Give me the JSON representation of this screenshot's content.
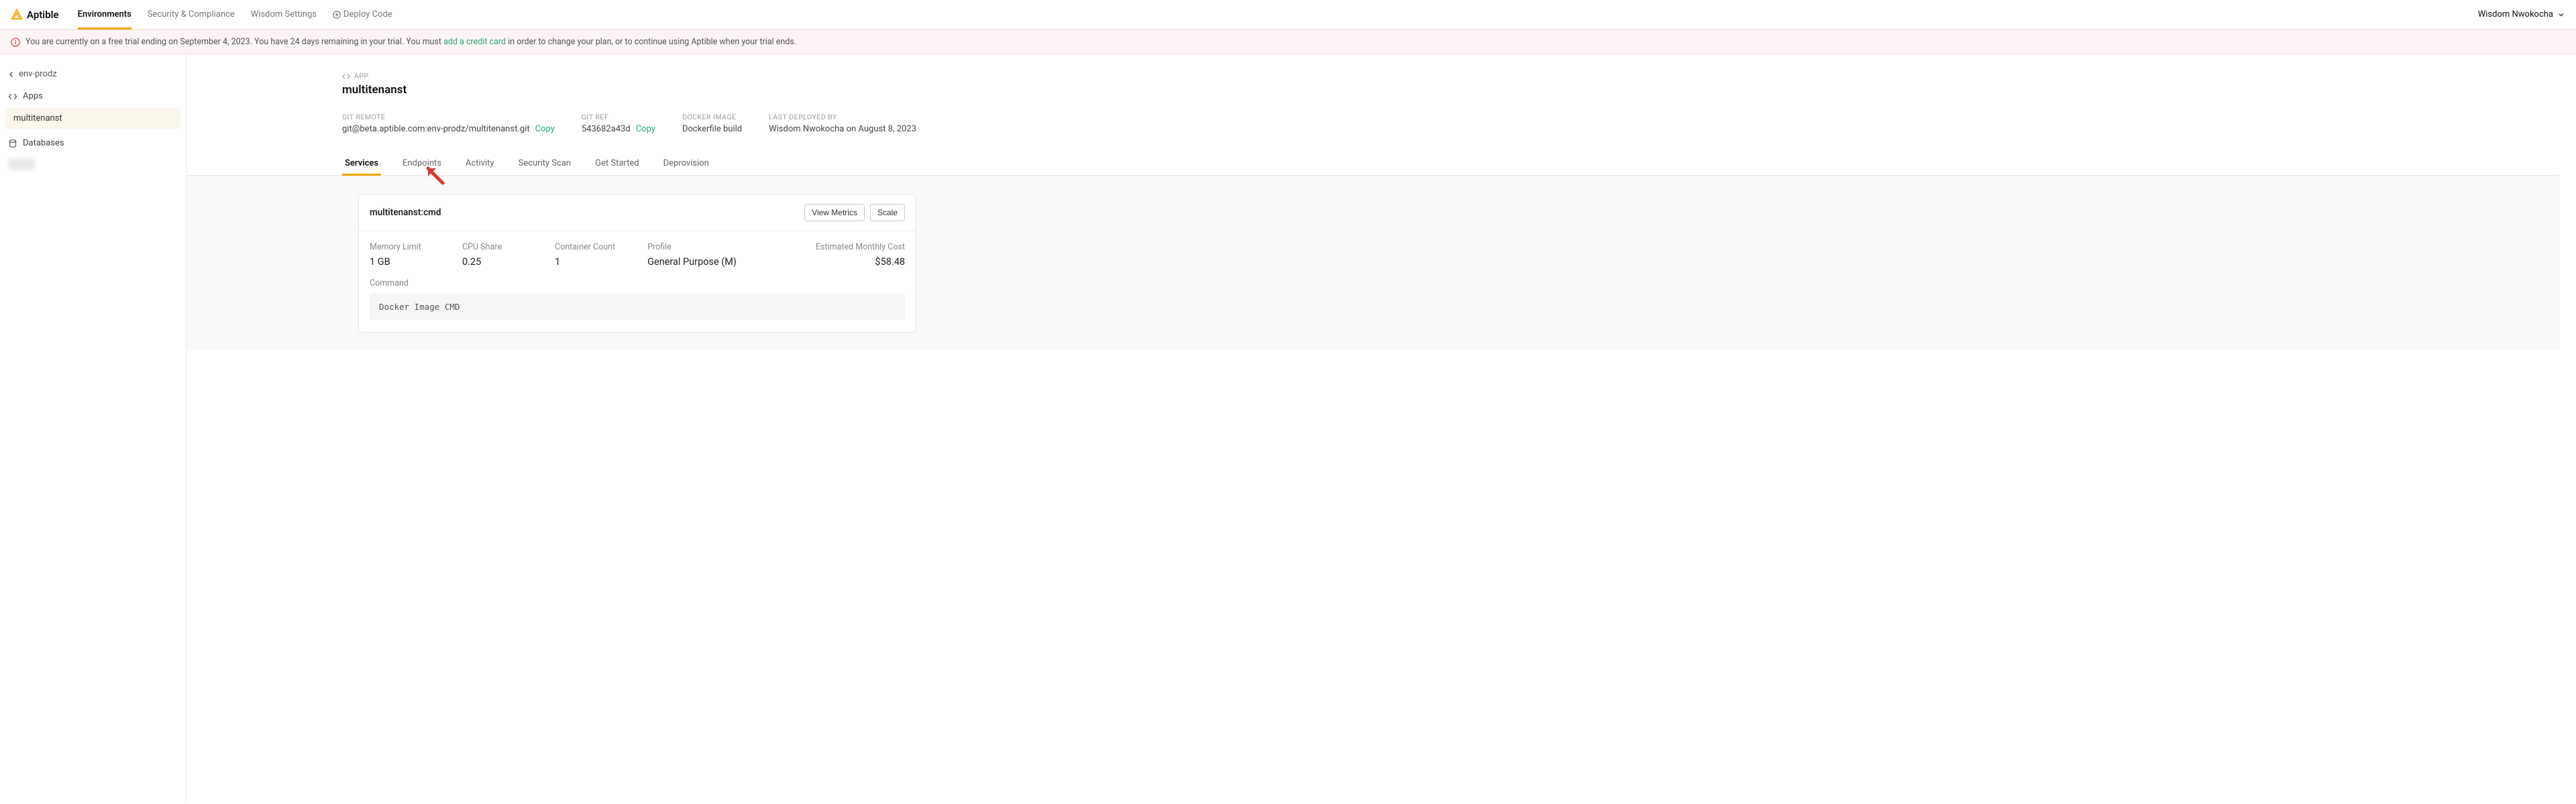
{
  "brand": {
    "name": "Aptible"
  },
  "topnav": {
    "items": [
      {
        "label": "Environments",
        "active": true
      },
      {
        "label": "Security & Compliance"
      },
      {
        "label": "Wisdom Settings"
      },
      {
        "label": "Deploy Code",
        "icon": "plus"
      }
    ],
    "user": "Wisdom Nwokocha"
  },
  "banner": {
    "text_before": "You are currently on a free trial ending on September 4, 2023. You have 24 days remaining in your trial. You must ",
    "link_text": "add a credit card",
    "text_after": " in order to change your plan, or to continue using Aptible when your trial ends."
  },
  "sidebar": {
    "back_label": "env-prodz",
    "sections": [
      {
        "icon": "code",
        "label": "Apps",
        "items": [
          {
            "label": "multitenanst",
            "active": true
          }
        ]
      },
      {
        "icon": "database",
        "label": "Databases",
        "items": []
      }
    ]
  },
  "header": {
    "crumb_label": "APP",
    "title": "multitenanst",
    "meta": {
      "git_remote": {
        "label": "GIT REMOTE",
        "value": "git@beta.aptible.com:env-prodz/multitenanst.git",
        "copy": "Copy"
      },
      "git_ref": {
        "label": "GIT REF",
        "value": "543682a43d",
        "copy": "Copy"
      },
      "docker_image": {
        "label": "DOCKER IMAGE",
        "value": "Dockerfile build"
      },
      "last_deployed": {
        "label": "LAST DEPLOYED BY",
        "value": "Wisdom Nwokocha on August 8, 2023"
      }
    }
  },
  "tabs": [
    {
      "label": "Services",
      "active": true
    },
    {
      "label": "Endpoints"
    },
    {
      "label": "Activity"
    },
    {
      "label": "Security Scan"
    },
    {
      "label": "Get Started"
    },
    {
      "label": "Deprovision"
    }
  ],
  "service_card": {
    "title": "multitenanst:cmd",
    "buttons": {
      "metrics": "View Metrics",
      "scale": "Scale"
    },
    "stats": {
      "memory_limit": {
        "label": "Memory Limit",
        "value": "1 GB"
      },
      "cpu_share": {
        "label": "CPU Share",
        "value": "0.25"
      },
      "container_count": {
        "label": "Container Count",
        "value": "1"
      },
      "profile": {
        "label": "Profile",
        "value": "General Purpose (M)"
      },
      "cost": {
        "label": "Estimated Monthly Cost",
        "value": "$58.48"
      }
    },
    "command": {
      "label": "Command",
      "value": "Docker Image CMD"
    }
  }
}
